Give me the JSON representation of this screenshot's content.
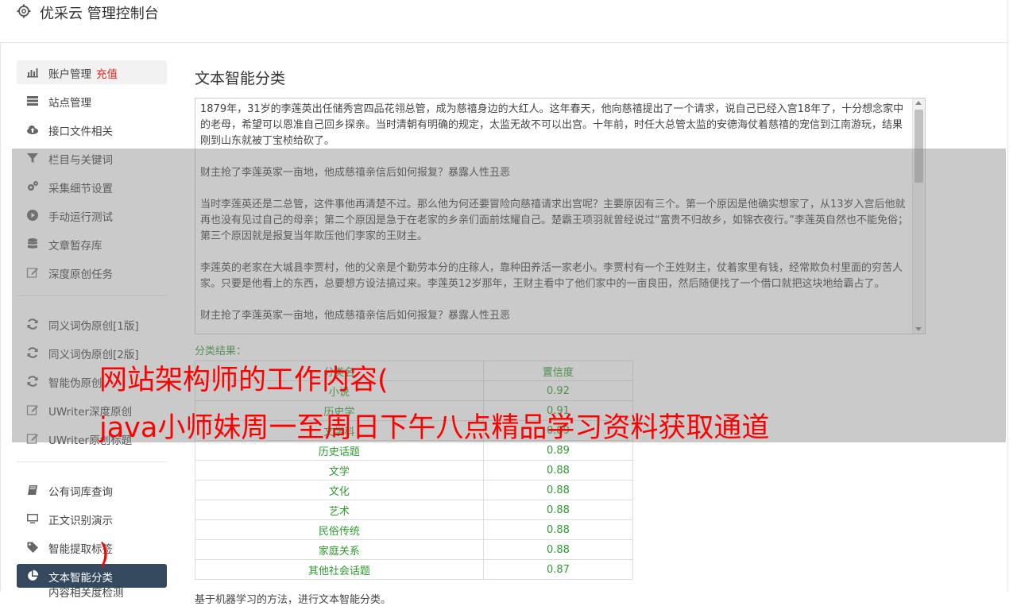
{
  "app": {
    "title": "优采云 管理控制台"
  },
  "sidebar": {
    "group1": [
      {
        "label": "账户管理",
        "extra": "充值",
        "icon": "bar-chart-icon"
      },
      {
        "label": "站点管理",
        "icon": "server-icon"
      },
      {
        "label": "接口文件相关",
        "icon": "cloud-upload-icon"
      },
      {
        "label": "栏目与关键词",
        "icon": "filter-icon"
      },
      {
        "label": "采集细节设置",
        "icon": "gears-icon"
      },
      {
        "label": "手动运行测试",
        "icon": "play-circle-icon"
      },
      {
        "label": "文章暂存库",
        "icon": "database-icon"
      },
      {
        "label": "深度原创任务",
        "icon": "edit-icon"
      }
    ],
    "group2": [
      {
        "label": "同义词伪原创[1版]",
        "icon": "refresh-icon"
      },
      {
        "label": "同义词伪原创[2版]",
        "icon": "refresh-icon"
      },
      {
        "label": "智能伪原创",
        "icon": "refresh-icon"
      },
      {
        "label": "UWriter深度原创",
        "icon": "edit-icon"
      },
      {
        "label": "UWriter原创标题",
        "icon": "edit-icon"
      }
    ],
    "group3": [
      {
        "label": "公有词库查询",
        "icon": "book-icon"
      },
      {
        "label": "正文识别演示",
        "icon": "monitor-icon"
      },
      {
        "label": "智能提取标签",
        "icon": "tag-icon"
      },
      {
        "label": "文本智能分类",
        "icon": "pie-chart-icon"
      }
    ],
    "cut_item": "内容相关度检测"
  },
  "main": {
    "heading": "文本智能分类",
    "paragraphs": [
      "1879年，31岁的李莲英出任储秀宫四品花翎总管，成为慈禧身边的大红人。这年春天，他向慈禧提出了一个请求，说自己已经入宫18年了，十分想念家中的老母，希望可以恩准自己回乡探亲。当时清朝有明确的规定，太监无故不可以出宫。十年前，时任大总管太监的安德海仗着慈禧的宠信到江南游玩，结果刚到山东就被丁宝桢给砍了。",
      "财主抢了李莲英家一亩地，他成慈禧亲信后如何报复？暴露人性丑恶",
      "当时李莲英还是二总管，这件事他再清楚不过。那么他为何还要冒险向慈禧请求出宫呢？主要原因有三个。第一个原因是他确实想家了，从13岁入宫后他就再也没有见过自己的母亲；第二个原因是急于在老家的乡亲们面前炫耀自己。楚霸王项羽就曾经说过“富贵不归故乡，如锦衣夜行。”李莲英自然也不能免俗；第三个原因就是报复当年欺压他们李家的王财主。",
      "李莲英的老家在大城县李贾村，他的父亲是个勤劳本分的庄稼人，靠种田养活一家老小。李贾村有一个王姓财主，仗着家里有钱，经常欺负村里面的穷苦人家。只要是他看上的东西，总要想方设法搞过来。李莲英12岁那年，王财主看中了他们家中的一亩良田，然后随便找了一个借口就把这块地给霸占了。",
      "财主抢了李莲英家一亩地，他成慈禧亲信后如何报复？暴露人性丑恶"
    ],
    "result_label": "分类结果：",
    "table": {
      "headers": [
        "分类名",
        "置信度"
      ],
      "rows": [
        [
          "小说",
          "0.92"
        ],
        [
          "历史学",
          "0.91"
        ],
        [
          "文学科",
          "0.89"
        ],
        [
          "历史话题",
          "0.89"
        ],
        [
          "文学",
          "0.88"
        ],
        [
          "文化",
          "0.88"
        ],
        [
          "艺术",
          "0.88"
        ],
        [
          "民俗传统",
          "0.88"
        ],
        [
          "家庭关系",
          "0.88"
        ],
        [
          "其他社会话题",
          "0.87"
        ]
      ]
    },
    "note": "基于机器学习的方法，进行文本智能分类。"
  },
  "overlay": {
    "line1": "网站架构师的工作内容(",
    "line2": "java小师妹周一至周日下午八点精品学习资料获取通道",
    "paren": ")"
  }
}
